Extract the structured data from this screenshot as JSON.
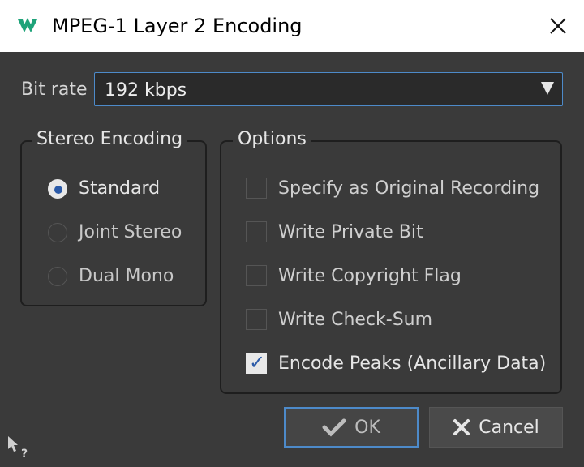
{
  "window": {
    "title": "MPEG-1 Layer 2 Encoding",
    "app_icon": "wavelab-logo-icon",
    "close_icon": "close-icon"
  },
  "bitrate": {
    "label": "Bit rate",
    "value": "192 kbps",
    "accent": "#4d8ac9"
  },
  "stereo_encoding": {
    "legend": "Stereo Encoding",
    "options": [
      {
        "label": "Standard",
        "selected": true
      },
      {
        "label": "Joint Stereo",
        "selected": false
      },
      {
        "label": "Dual Mono",
        "selected": false
      }
    ]
  },
  "options": {
    "legend": "Options",
    "items": [
      {
        "label": "Specify as Original Recording",
        "checked": false
      },
      {
        "label": "Write Private Bit",
        "checked": false
      },
      {
        "label": "Write Copyright Flag",
        "checked": false
      },
      {
        "label": "Write Check-Sum",
        "checked": false
      },
      {
        "label": "Encode Peaks (Ancillary Data)",
        "checked": true
      }
    ]
  },
  "buttons": {
    "ok": "OK",
    "cancel": "Cancel"
  },
  "help_icon": "whats-this-help-icon"
}
